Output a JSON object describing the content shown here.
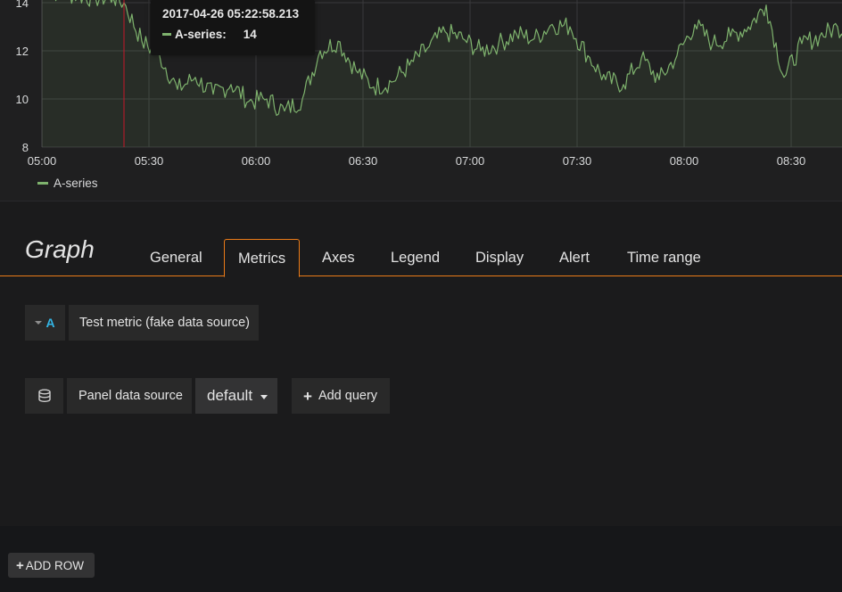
{
  "chart_data": {
    "type": "line",
    "x_ticks": [
      "05:00",
      "05:30",
      "06:00",
      "06:30",
      "07:00",
      "07:30",
      "08:00",
      "08:30"
    ],
    "y_ticks": [
      "8",
      "10",
      "12",
      "14"
    ],
    "ylim": [
      8,
      14
    ],
    "xlim": [
      "05:00",
      "08:48"
    ],
    "grid": true,
    "legend": "bottom-left",
    "series": [
      {
        "name": "A-series",
        "color": "#7eb26d",
        "x": [
          "05:00",
          "05:05",
          "05:10",
          "05:15",
          "05:20",
          "05:23",
          "05:28",
          "05:33",
          "05:38",
          "05:43",
          "05:48",
          "05:53",
          "05:58",
          "06:03",
          "06:08",
          "06:13",
          "06:18",
          "06:23",
          "06:28",
          "06:33",
          "06:38",
          "06:43",
          "06:48",
          "06:53",
          "06:58",
          "07:03",
          "07:08",
          "07:13",
          "07:18",
          "07:23",
          "07:28",
          "07:33",
          "07:38",
          "07:43",
          "07:48",
          "07:53",
          "07:58",
          "08:03",
          "08:08",
          "08:13",
          "08:18",
          "08:23",
          "08:28",
          "08:33",
          "08:38",
          "08:43",
          "08:48"
        ],
        "values": [
          14.6,
          14.4,
          14.3,
          14.2,
          14.2,
          14.0,
          12.4,
          11.8,
          10.4,
          10.9,
          10.2,
          10.6,
          9.9,
          10.0,
          9.5,
          10.0,
          12.0,
          12.4,
          11.2,
          10.5,
          10.7,
          11.4,
          12.1,
          12.8,
          12.5,
          12.0,
          12.3,
          12.7,
          12.5,
          13.1,
          13.0,
          11.8,
          10.8,
          10.6,
          11.7,
          10.8,
          11.8,
          13.1,
          12.3,
          12.6,
          13.0,
          13.9,
          10.9,
          12.3,
          12.6,
          13.0,
          12.6
        ]
      }
    ],
    "cursor_x": "05:23"
  },
  "tooltip": {
    "time": "2017-04-26 05:22:58.213",
    "series_label": "A-series:",
    "value": "14"
  },
  "legend": {
    "series_name": "A-series"
  },
  "editor": {
    "title": "Graph",
    "tabs": [
      "General",
      "Metrics",
      "Axes",
      "Legend",
      "Display",
      "Alert",
      "Time range"
    ],
    "active_tab": "Metrics",
    "query": {
      "ref_id": "A",
      "description": "Test metric (fake data source)"
    },
    "datasource": {
      "icon": "database-icon",
      "label": "Panel data source",
      "value": "default",
      "add_query_label": "Add query"
    }
  },
  "add_row_label": "ADD ROW",
  "colors": {
    "series": "#7eb26d",
    "cursor": "#c4162a",
    "tab_accent": "#eb7b18",
    "query_ref": "#33b5e5"
  }
}
